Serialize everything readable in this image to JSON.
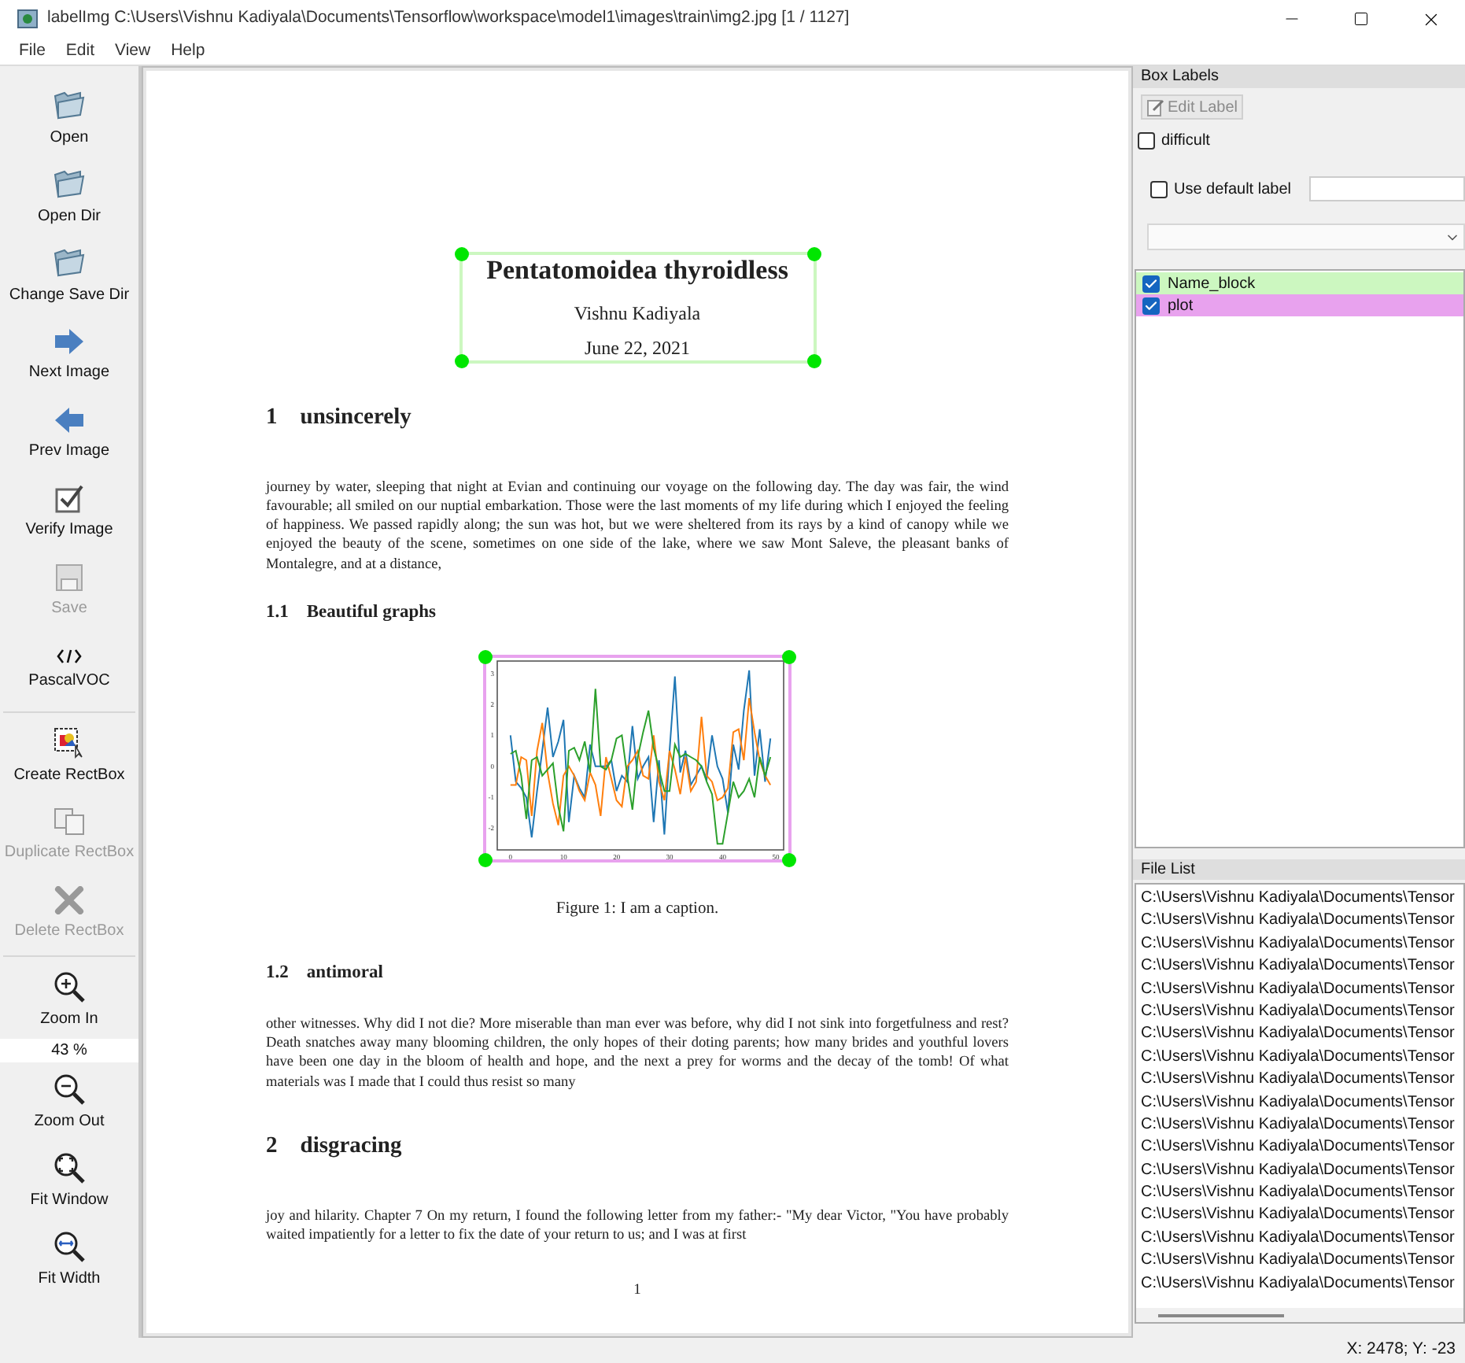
{
  "window": {
    "title": "labelImg C:\\Users\\Vishnu Kadiyala\\Documents\\Tensorflow\\workspace\\model1\\images\\train\\img2.jpg [1 / 1127]"
  },
  "menu": [
    "File",
    "Edit",
    "View",
    "Help"
  ],
  "toolbar": [
    {
      "kind": "folder",
      "label": "Open",
      "disabled": false
    },
    {
      "kind": "folder",
      "label": "Open Dir",
      "disabled": false
    },
    {
      "kind": "folder",
      "label": "Change Save Dir",
      "disabled": false
    },
    {
      "kind": "next",
      "label": "Next Image",
      "disabled": false
    },
    {
      "kind": "prev",
      "label": "Prev Image",
      "disabled": false
    },
    {
      "kind": "verify",
      "label": "Verify Image",
      "disabled": false
    },
    {
      "kind": "save",
      "label": "Save",
      "disabled": true
    },
    {
      "kind": "format",
      "label": "PascalVOC",
      "disabled": false
    },
    {
      "kind": "separator"
    },
    {
      "kind": "create",
      "label": "Create RectBox",
      "disabled": false
    },
    {
      "kind": "duplicate",
      "label": "Duplicate RectBox",
      "disabled": true
    },
    {
      "kind": "delete",
      "label": "Delete RectBox",
      "disabled": true
    },
    {
      "kind": "separator"
    },
    {
      "kind": "zoomin",
      "label": "Zoom In",
      "disabled": false
    },
    {
      "kind": "zoomvalue",
      "label": "43 %"
    },
    {
      "kind": "zoomout",
      "label": "Zoom Out",
      "disabled": false
    },
    {
      "kind": "fitwindow",
      "label": "Fit Window",
      "disabled": false
    },
    {
      "kind": "fitwidth",
      "label": "Fit Width",
      "disabled": false
    }
  ],
  "document": {
    "title": "Pentatomoidea thyroidless",
    "author": "Vishnu Kadiyala",
    "date": "June 22, 2021",
    "blocks": [
      {
        "kind": "section",
        "number": "1",
        "text": "unsincerely"
      },
      {
        "kind": "paragraph",
        "text": "journey by water, sleeping that night at Evian and continuing our voyage on the following day.  The day was fair, the wind favourable; all smiled on our nuptial embarkation.  Those were the last moments of my life during which I enjoyed the feeling of happiness. We passed rapidly along; the sun was hot, but we were sheltered from its rays by a kind of canopy while we enjoyed the beauty of the scene, sometimes on one side of the lake, where we saw Mont Saleve, the pleasant banks of Montalegre, and at a distance,"
      },
      {
        "kind": "subsection",
        "number": "1.1",
        "text": "Beautiful graphs"
      },
      {
        "kind": "figure",
        "caption": "Figure 1: I am a caption.",
        "chart_data": {
          "type": "line",
          "x": [
            0,
            1,
            2,
            3,
            4,
            5,
            6,
            7,
            8,
            9,
            10,
            11,
            12,
            13,
            14,
            15,
            16,
            17,
            18,
            19,
            20,
            21,
            22,
            23,
            24,
            25,
            26,
            27,
            28,
            29,
            30,
            31,
            32,
            33,
            34,
            35,
            36,
            37,
            38,
            39,
            40,
            41,
            42,
            43,
            44,
            45,
            46,
            47,
            48,
            49
          ],
          "xlim": [
            -2.5,
            51.5
          ],
          "ylim": [
            -2.7,
            3.4
          ],
          "xticks": [
            0,
            10,
            20,
            30,
            40,
            50
          ],
          "yticks": [
            -2,
            -1,
            0,
            1,
            2,
            3
          ],
          "series": [
            {
              "color": "#1f77b4",
              "values": [
                1,
                -0.5,
                -0.7,
                -1,
                -2.3,
                -0.8,
                0.5,
                1.9,
                0.3,
                0.8,
                1.5,
                -1.8,
                -0.3,
                -0.7,
                -1,
                0.7,
                0,
                0,
                0,
                0.2,
                -0.8,
                -0.3,
                -0.5,
                1.3,
                -0.4,
                0,
                0.3,
                -1.8,
                0.2,
                -2.2,
                0.5,
                2.9,
                -0.2,
                0.5,
                -0.6,
                -0.3,
                0,
                -0.4,
                1,
                0,
                -0.4,
                -1.5,
                0.7,
                -0.1,
                1.8,
                3.1,
                -0.3,
                1.2,
                -0.5,
                0.9
              ]
            },
            {
              "color": "#ff7f0e",
              "values": [
                -0.6,
                -0.6,
                0.3,
                0.2,
                -1.6,
                0.5,
                1.4,
                -0.2,
                -1.2,
                -1.9,
                -0.3,
                0,
                -0.3,
                -0.8,
                -1.1,
                -0.2,
                -0.6,
                -1.6,
                0.3,
                -0.4,
                -1.1,
                -1.3,
                0,
                0.2,
                0.5,
                -0.3,
                -0.4,
                1,
                -0.5,
                -1.1,
                0.5,
                -0.1,
                -0.9,
                0.3,
                -0.8,
                -0.5,
                1.6,
                -0.3,
                -0.5,
                -1.1,
                -1,
                -0.7,
                1.1,
                1.2,
                0.2,
                2.2,
                1.1,
                0.2,
                -0.3,
                -0.6
              ]
            },
            {
              "color": "#2ca02c",
              "values": [
                0.4,
                0.5,
                -0.3,
                -1.7,
                0.2,
                0.3,
                -0.3,
                -0.1,
                0.1,
                -1.3,
                -2.1,
                0.5,
                0.6,
                0.2,
                0.8,
                -0.2,
                2.5,
                0,
                -0.1,
                0.2,
                0.9,
                1,
                -0.3,
                -1.4,
                0.3,
                1.1,
                1.8,
                0.6,
                -0.1,
                -0.8,
                -0.8,
                0.7,
                0.3,
                0.4,
                0.3,
                0.2,
                0,
                -0.5,
                -0.9,
                -2.5,
                -2.5,
                -1.5,
                -0.5,
                -1,
                -0.8,
                -0.4,
                -1,
                0.3,
                -0.3,
                0.3
              ]
            }
          ]
        }
      },
      {
        "kind": "subsection",
        "number": "1.2",
        "text": "antimoral"
      },
      {
        "kind": "paragraph",
        "text": "other witnesses.  Why did I not die?  More miserable than man ever was before, why did I not sink into forgetfulness and rest?  Death snatches away many blooming children, the only hopes of their doting parents; how many brides and youthful lovers have been one day in the bloom of health and hope, and the next a prey for worms and the decay of the tomb!  Of what materials was I made that I could thus resist so many"
      },
      {
        "kind": "section",
        "number": "2",
        "text": "disgracing"
      },
      {
        "kind": "paragraph",
        "text": "joy and hilarity.  Chapter 7 On my return, I found the following letter from my father:- \"My dear Victor, \"You have probably waited impatiently for a letter to fix the date of your return to us; and I was at first"
      }
    ],
    "page_number": "1"
  },
  "box_labels": {
    "header": "Box Labels",
    "edit_button": "Edit Label",
    "edit_disabled": true,
    "difficult": {
      "label": "difficult",
      "checked": false
    },
    "use_default": {
      "label": "Use default label",
      "checked": false
    },
    "labels": [
      {
        "text": "Name_block",
        "checked": true,
        "color": "#ccf7c0"
      },
      {
        "text": "plot",
        "checked": true,
        "color": "#e8a2ee"
      }
    ]
  },
  "file_list": {
    "header": "File List",
    "items": [
      "C:\\Users\\Vishnu Kadiyala\\Documents\\Tensor",
      "C:\\Users\\Vishnu Kadiyala\\Documents\\Tensor",
      "C:\\Users\\Vishnu Kadiyala\\Documents\\Tensor",
      "C:\\Users\\Vishnu Kadiyala\\Documents\\Tensor",
      "C:\\Users\\Vishnu Kadiyala\\Documents\\Tensor",
      "C:\\Users\\Vishnu Kadiyala\\Documents\\Tensor",
      "C:\\Users\\Vishnu Kadiyala\\Documents\\Tensor",
      "C:\\Users\\Vishnu Kadiyala\\Documents\\Tensor",
      "C:\\Users\\Vishnu Kadiyala\\Documents\\Tensor",
      "C:\\Users\\Vishnu Kadiyala\\Documents\\Tensor",
      "C:\\Users\\Vishnu Kadiyala\\Documents\\Tensor",
      "C:\\Users\\Vishnu Kadiyala\\Documents\\Tensor",
      "C:\\Users\\Vishnu Kadiyala\\Documents\\Tensor",
      "C:\\Users\\Vishnu Kadiyala\\Documents\\Tensor",
      "C:\\Users\\Vishnu Kadiyala\\Documents\\Tensor",
      "C:\\Users\\Vishnu Kadiyala\\Documents\\Tensor",
      "C:\\Users\\Vishnu Kadiyala\\Documents\\Tensor",
      "C:\\Users\\Vishnu Kadiyala\\Documents\\Tensor"
    ]
  },
  "status_bar": "X: 2478; Y: -23"
}
